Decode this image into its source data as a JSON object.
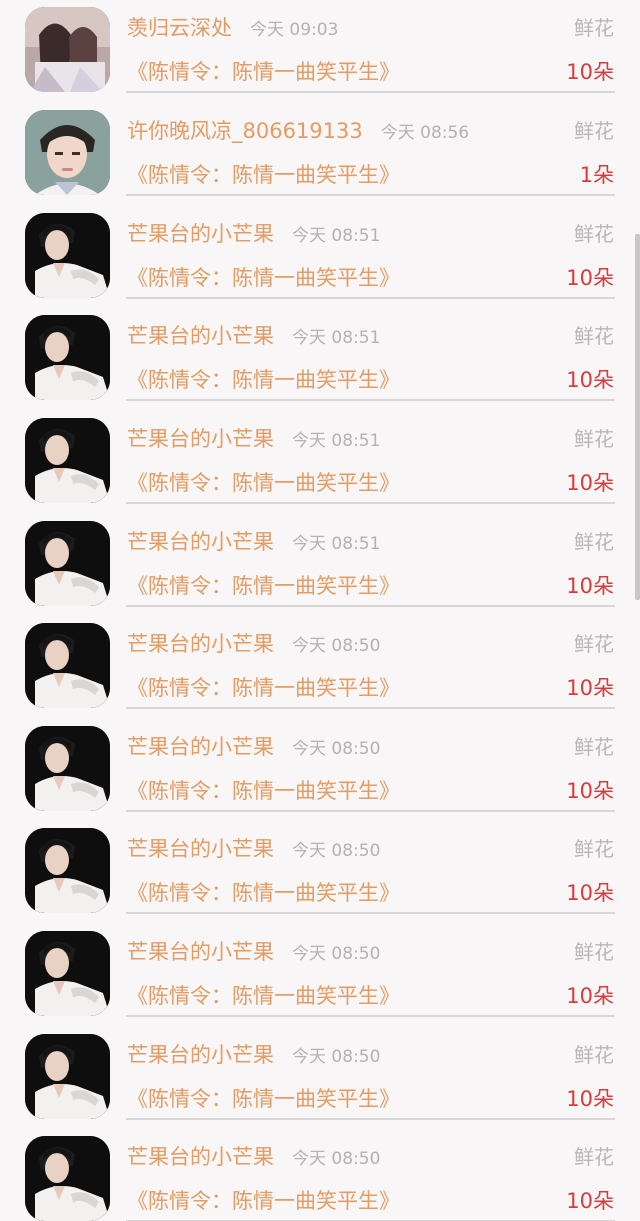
{
  "items": [
    {
      "user": "羡归云深处",
      "time": "今天 09:03",
      "gift": "鲜花",
      "title": "《陈情令：陈情一曲笑平生》",
      "count": "10朵",
      "avatar": "avatar-a"
    },
    {
      "user": "许你晚风凉_806619133",
      "time": "今天 08:56",
      "gift": "鲜花",
      "title": "《陈情令：陈情一曲笑平生》",
      "count": "1朵",
      "avatar": "avatar-b"
    },
    {
      "user": "芒果台的小芒果",
      "time": "今天 08:51",
      "gift": "鲜花",
      "title": "《陈情令：陈情一曲笑平生》",
      "count": "10朵",
      "avatar": "avatar-c"
    },
    {
      "user": "芒果台的小芒果",
      "time": "今天 08:51",
      "gift": "鲜花",
      "title": "《陈情令：陈情一曲笑平生》",
      "count": "10朵",
      "avatar": "avatar-c"
    },
    {
      "user": "芒果台的小芒果",
      "time": "今天 08:51",
      "gift": "鲜花",
      "title": "《陈情令：陈情一曲笑平生》",
      "count": "10朵",
      "avatar": "avatar-c"
    },
    {
      "user": "芒果台的小芒果",
      "time": "今天 08:51",
      "gift": "鲜花",
      "title": "《陈情令：陈情一曲笑平生》",
      "count": "10朵",
      "avatar": "avatar-c"
    },
    {
      "user": "芒果台的小芒果",
      "time": "今天 08:50",
      "gift": "鲜花",
      "title": "《陈情令：陈情一曲笑平生》",
      "count": "10朵",
      "avatar": "avatar-c"
    },
    {
      "user": "芒果台的小芒果",
      "time": "今天 08:50",
      "gift": "鲜花",
      "title": "《陈情令：陈情一曲笑平生》",
      "count": "10朵",
      "avatar": "avatar-c"
    },
    {
      "user": "芒果台的小芒果",
      "time": "今天 08:50",
      "gift": "鲜花",
      "title": "《陈情令：陈情一曲笑平生》",
      "count": "10朵",
      "avatar": "avatar-c"
    },
    {
      "user": "芒果台的小芒果",
      "time": "今天 08:50",
      "gift": "鲜花",
      "title": "《陈情令：陈情一曲笑平生》",
      "count": "10朵",
      "avatar": "avatar-c"
    },
    {
      "user": "芒果台的小芒果",
      "time": "今天 08:50",
      "gift": "鲜花",
      "title": "《陈情令：陈情一曲笑平生》",
      "count": "10朵",
      "avatar": "avatar-c"
    },
    {
      "user": "芒果台的小芒果",
      "time": "今天 08:50",
      "gift": "鲜花",
      "title": "《陈情令：陈情一曲笑平生》",
      "count": "10朵",
      "avatar": "avatar-c"
    }
  ],
  "colors": {
    "username": "#e39c63",
    "title": "#e39c63",
    "count": "#d93a3a",
    "meta": "#b4b1b3",
    "background": "#f8f6f7"
  }
}
